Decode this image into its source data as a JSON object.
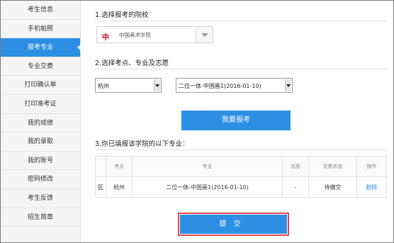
{
  "sidebar": {
    "items": [
      {
        "label": "考生信息"
      },
      {
        "label": "手机帕照"
      },
      {
        "label": "报考专业"
      },
      {
        "label": "专业交费"
      },
      {
        "label": "打印确认单"
      },
      {
        "label": "打印准考证"
      },
      {
        "label": "我的成绩"
      },
      {
        "label": "我的录取"
      },
      {
        "label": "我的账号"
      },
      {
        "label": "密码修改"
      },
      {
        "label": "考生反馈"
      },
      {
        "label": "招生简章"
      }
    ],
    "active_index": 2
  },
  "step1": {
    "title": "1.选择报考的院校",
    "school_logo": "中",
    "school_name": "中国美术学院"
  },
  "step2": {
    "title": "2.选择考点、专业及志愿",
    "site_value": "杭州",
    "major_value": "二位一体-中国画1(2016-01-10)",
    "apply_label": "我要报考"
  },
  "step3": {
    "title": "3.你已填报该学院的以下专业：",
    "headers": [
      "",
      "考点",
      "专业",
      "志愿",
      "交费状态",
      "操作"
    ],
    "rows": [
      {
        "mark": "区",
        "site": "杭州",
        "major": "二位一体-中国画1(2016-01-10)",
        "choice": "-",
        "status": "待缴交",
        "action": "删除"
      }
    ]
  },
  "submit_label": "提交"
}
